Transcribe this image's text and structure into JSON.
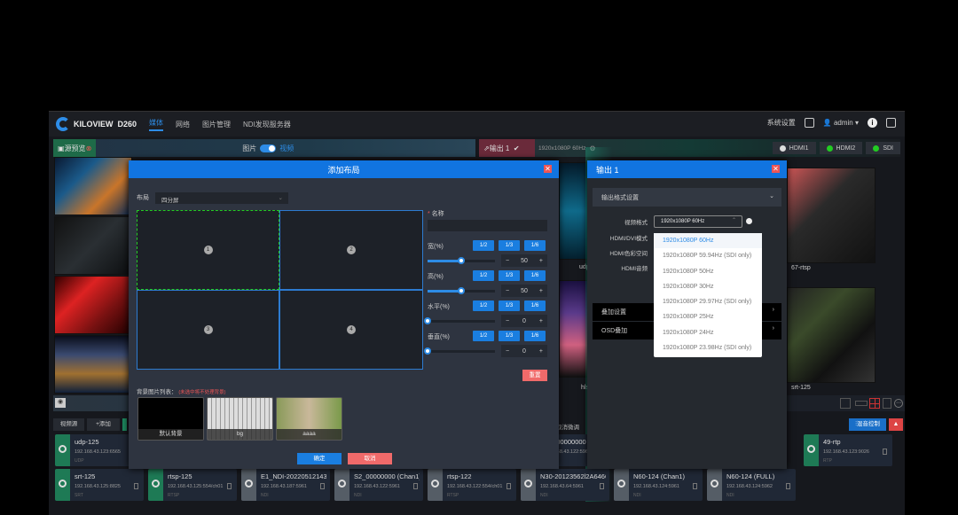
{
  "header": {
    "brand": "KILOVIEW",
    "model": "D260",
    "nav": [
      "媒体",
      "网络",
      "图片管理",
      "NDI发现服务器"
    ],
    "system_settings": "系统设置",
    "user": "admin"
  },
  "preview_bar": {
    "label": "源预览",
    "toggle_left": "图片",
    "toggle_right": "视频"
  },
  "output_bar": {
    "label": "输出 1",
    "format": "1920x1080P 60Hz",
    "ports": [
      {
        "name": "HDMI1",
        "color": "#dddddd"
      },
      {
        "name": "HDMI2",
        "color": "#22cc22"
      },
      {
        "name": "SDI",
        "color": "#22cc22"
      }
    ]
  },
  "thumb_labels": {
    "right_top": "67-rtsp",
    "right_bottom": "srt-125",
    "mid_top": "udp",
    "mid_bottom": "hls"
  },
  "toolbar": {
    "sources": "视频源",
    "add": "+添加",
    "cancel_adjust": "取消微调",
    "mixer": "混音控制"
  },
  "add_layout": {
    "title": "添加布局",
    "layout_label": "布局",
    "layout_value": "四分屏",
    "cells": [
      "1",
      "2",
      "3",
      "4"
    ],
    "name_label": "名称",
    "name_value": "",
    "params": [
      {
        "label": "宽(%)",
        "value": 50
      },
      {
        "label": "高(%)",
        "value": 50
      },
      {
        "label": "水平(%)",
        "value": 0
      },
      {
        "label": "垂直(%)",
        "value": 0
      }
    ],
    "fractions": [
      "1/2",
      "1/3",
      "1/6"
    ],
    "reset": "重置",
    "bg_list_label": "背景图片列表：",
    "bg_hint": "(未选中将不处理背景)",
    "backgrounds": [
      "默认背景",
      "bg",
      "aaaa"
    ],
    "ok": "确定",
    "cancel": "取消"
  },
  "output_dialog": {
    "title": "输出 1",
    "section": "输出格式设置",
    "video_format_label": "视频格式",
    "video_format_value": "1920x1080P 60Hz",
    "fields": [
      "HDMI/DVI模式",
      "HDMI色彩空间",
      "HDMI音频"
    ],
    "overlay": "叠加设置",
    "osd": "OSD叠加",
    "options": [
      "1920x1080P 60Hz",
      "1920x1080P 59.94Hz (SDI only)",
      "1920x1080P 50Hz",
      "1920x1080P 30Hz",
      "1920x1080P 29.97Hz (SDI only)",
      "1920x1080P 25Hz",
      "1920x1080P 24Hz",
      "1920x1080P 23.98Hz (SDI only)"
    ]
  },
  "sources_row1": [
    {
      "name": "udp-125",
      "ip": "192.168.43.123:6565",
      "type": "UDP",
      "green": true
    },
    {
      "name": "S2_00000000 (Chan1)",
      "ip": "192.168.43.122:5962",
      "type": "NDI",
      "green": false
    },
    {
      "name": "49-rtp",
      "ip": "192.168.43.123:9026",
      "type": "RTP",
      "green": true
    }
  ],
  "sources_row2": [
    {
      "name": "srt-125",
      "ip": "192.168.43.125:8825",
      "type": "SRT",
      "green": true
    },
    {
      "name": "rtsp-125",
      "ip": "192.168.43.125:554/ch01",
      "type": "RTSP",
      "green": true
    },
    {
      "name": "E1_NDI-202205121439...",
      "ip": "192.168.43.187:5961",
      "type": "NDI",
      "green": false
    },
    {
      "name": "S2_00000000 (Chan1)",
      "ip": "192.168.43.122:5961",
      "type": "NDI",
      "green": false
    },
    {
      "name": "rtsp-122",
      "ip": "192.168.43.122:554/ch01",
      "type": "RTSP",
      "green": false
    },
    {
      "name": "N30-20123562l2A6466...",
      "ip": "192.168.43.64:5961",
      "type": "NDI",
      "green": false
    },
    {
      "name": "N60-124 (Chan1)",
      "ip": "192.168.43.124:5961",
      "type": "NDI",
      "green": false
    },
    {
      "name": "N60-124 (FULL)",
      "ip": "192.168.43.124:5962",
      "type": "NDI",
      "green": false
    }
  ]
}
